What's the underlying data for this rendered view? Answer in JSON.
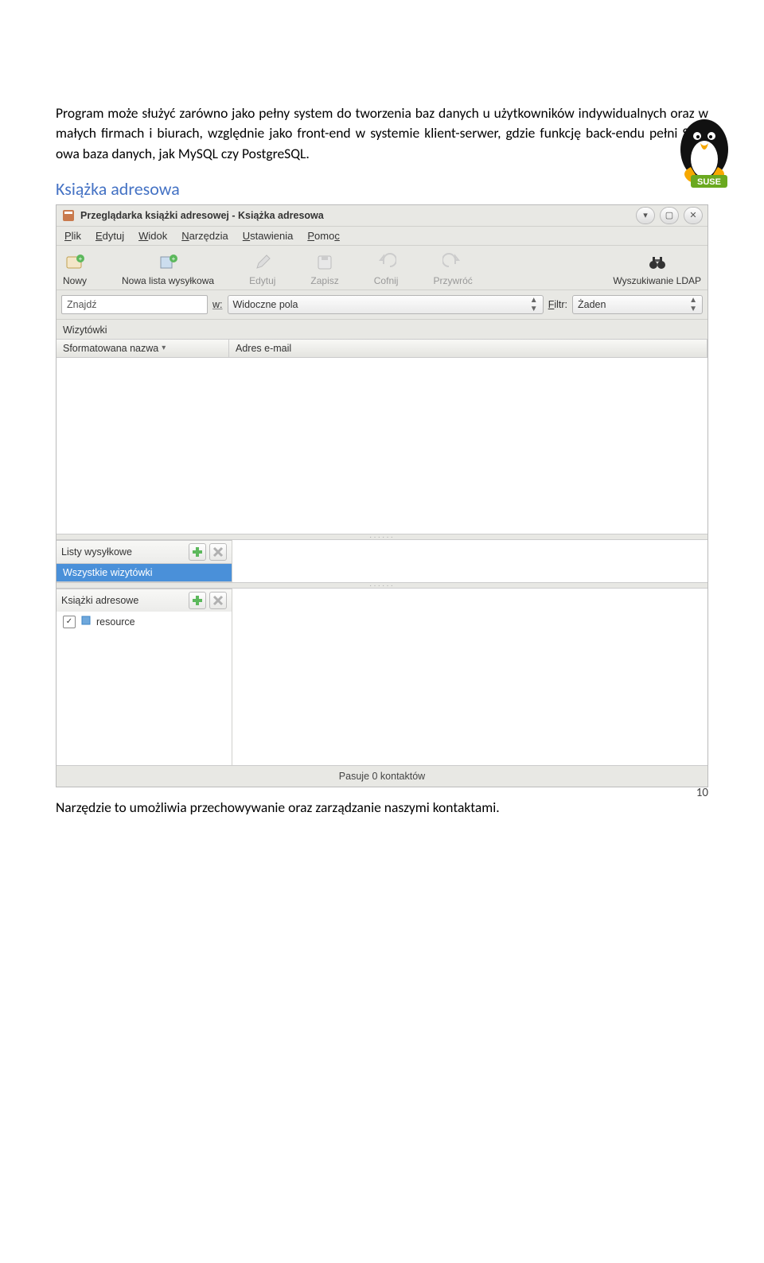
{
  "page": {
    "number": "10",
    "paragraph1": "Program może służyć zarówno jako pełny system do tworzenia baz danych u użytkowników indywidualnych oraz w małych firmach i biurach, względnie jako front-end w systemie klient-serwer, gdzie funkcję back-endu pełni SQL-owa baza danych, jak MySQL czy PostgreSQL.",
    "heading": "Książka adresowa",
    "paragraph2": "Narzędzie to umożliwia przechowywanie oraz zarządzanie naszymi kontaktami."
  },
  "app": {
    "title": "Przeglądarka książki adresowej - Książka adresowa",
    "menu": {
      "file": "Plik",
      "edit": "Edytuj",
      "view": "Widok",
      "tools": "Narzędzia",
      "settings": "Ustawienia",
      "help": "Pomoc"
    },
    "toolbar": {
      "new": "Nowy",
      "newList": "Nowa lista wysyłkowa",
      "edit": "Edytuj",
      "save": "Zapisz",
      "undo": "Cofnij",
      "redo": "Przywróć",
      "ldap": "Wyszukiwanie LDAP"
    },
    "search": {
      "find_label": "Znajdź",
      "in_label": "w:",
      "field_value": "Widoczne pola",
      "filter_label": "Filtr:",
      "filter_value": "Żaden"
    },
    "left": {
      "cards_label": "Wizytówki",
      "col1": "Sformatowana nazwa",
      "col2": "Adres e-mail",
      "lists_label": "Listy wysyłkowe",
      "all_cards": "Wszystkie wizytówki",
      "books_label": "Książki adresowe",
      "resource": "resource"
    },
    "status": "Pasuje 0 kontaktów"
  }
}
